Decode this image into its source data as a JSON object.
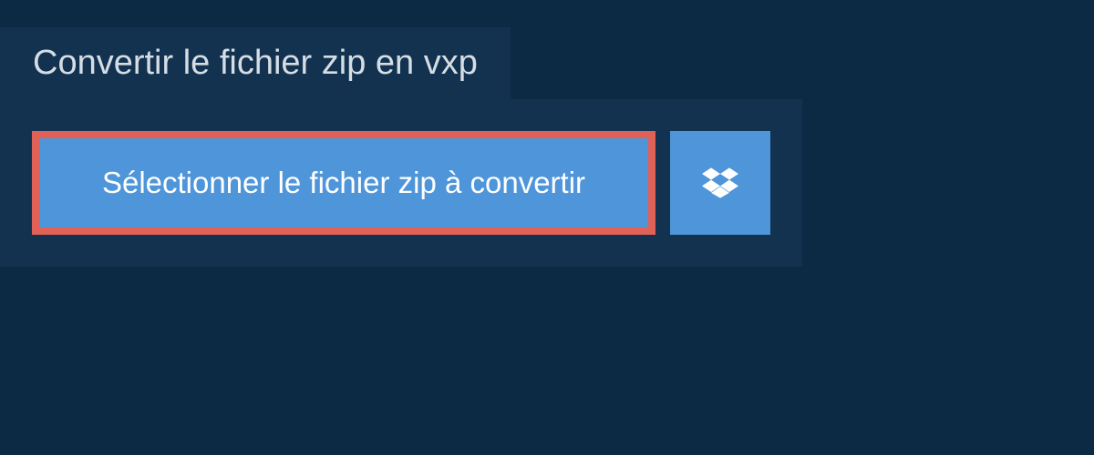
{
  "header": {
    "title": "Convertir le fichier zip en vxp"
  },
  "upload": {
    "select_label": "Sélectionner le fichier zip à convertir"
  }
}
